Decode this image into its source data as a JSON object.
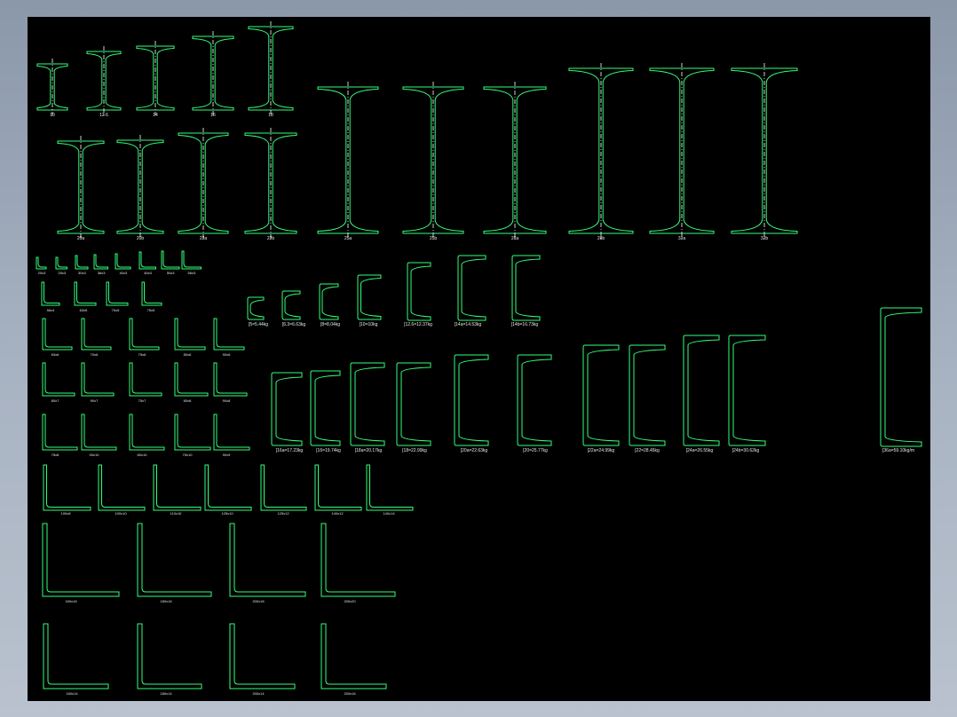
{
  "colors": {
    "line": "#32ff7a",
    "axis": "#ffffff",
    "label": "#e8e8e8",
    "background": "#000000"
  },
  "i_beams": [
    "10",
    "12.6",
    "14",
    "16",
    "18",
    "20a",
    "20b",
    "22a",
    "22b",
    "25a",
    "25b",
    "28a",
    "28b",
    "32a",
    "32b",
    "32c"
  ],
  "small_angles": [
    "20x3",
    "25x3",
    "30x3",
    "36x3",
    "40x3",
    "45x3",
    "50x3",
    "56x3"
  ],
  "medium_angles": [
    "56x4",
    "63x5",
    "70x5",
    "75x5"
  ],
  "angle_grid": [
    "63x6",
    "70x6",
    "75x6",
    "80x6",
    "90x6",
    "80x7",
    "90x7",
    "75x7",
    "80x8",
    "90x8",
    "75x8",
    "90x10",
    "80x10",
    "75x10",
    "90x9"
  ],
  "large_angles": [
    "100x8",
    "100x10",
    "110x10",
    "125x10",
    "125x12",
    "140x12",
    "140x14"
  ],
  "xl_angles": [
    "160x16",
    "180x16",
    "200x18",
    "200x20",
    "160x14",
    "180x14",
    "200x14",
    "200x16"
  ],
  "channels": [
    "[5=5.44kg",
    "[6.3=6.63kg",
    "[8=8.04kg",
    "[10=10kg",
    "[12.6=12.37kg",
    "[14a=14.53kg",
    "[14b=16.73kg",
    "[16a=17.23kg",
    "[16=19.74kg",
    "[18a=20.17kg",
    "[18=22.99kg",
    "[20a=22.63kg",
    "[20=25.77kg",
    "[22a=24.99kg",
    "[22=28.45kg",
    "[24a=26.55kg",
    "[24b=30.62kg",
    "[36a=59.10kg/m"
  ]
}
